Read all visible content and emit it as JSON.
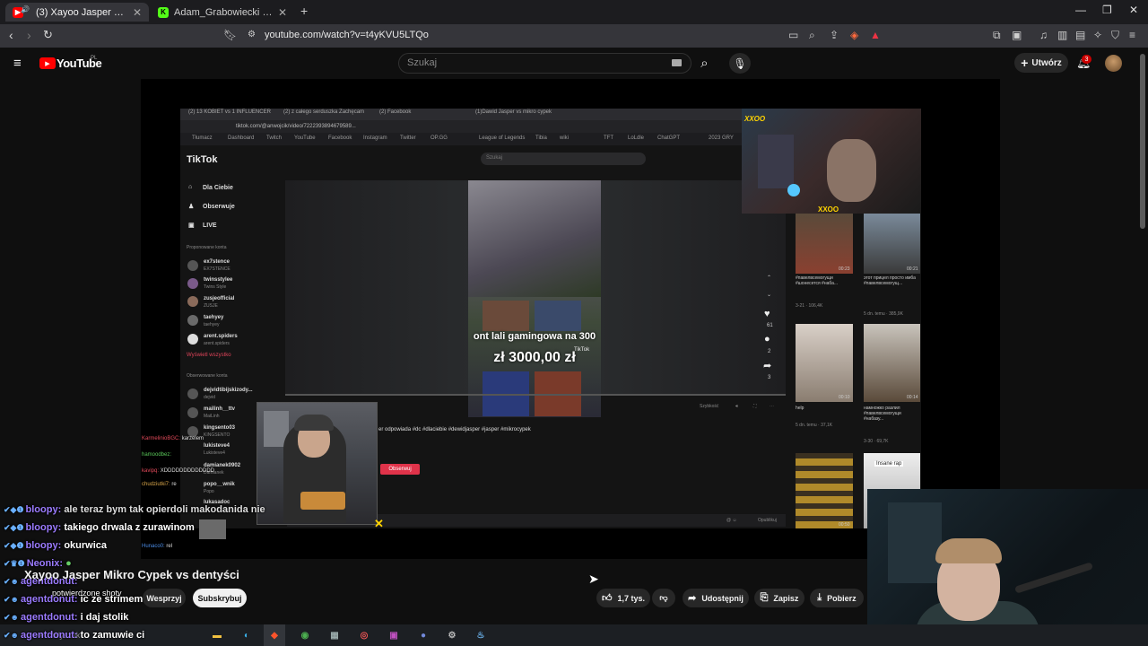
{
  "browser": {
    "tabs": [
      {
        "title": "(3) Xayoo Jasper Mikro Cypek",
        "active": true
      },
      {
        "title": "Adam_Grabowiecki Stream - Watch L",
        "active": false
      }
    ],
    "url": "youtube.com/watch?v=t4yKVU5LTQo"
  },
  "youtube": {
    "logo": "YouTube",
    "region": "PL",
    "search_placeholder": "Szukaj",
    "create_label": "Utwórz",
    "notification_count": "3",
    "video_title": "Xayoo Jasper Mikro Cypek vs dentyści",
    "support_label": "Wesprzyj",
    "subscribe_label": "Subskrybuj",
    "like_count": "1,7 tys.",
    "share_label": "Udostępnij",
    "save_label": "Zapisz",
    "download_label": "Pobierz"
  },
  "stream": {
    "inner_tabs": [
      "(2) 13 KOBIET vs 1 INFLUENCER",
      "(2) z całego serduszka Zachęcam",
      "(2) Facebook",
      "(1)Dawid Jasper vs mikro cypek"
    ],
    "inner_url": "tiktok.com/@anwojcik/video/7222393894679589...",
    "bookmarks": [
      "Tłumacz",
      "Dashboard",
      "Twitch",
      "YouTube",
      "Facebook",
      "Instagram",
      "Twitter",
      "OP.GG",
      "League of Legends",
      "Tibia",
      "wiki",
      "TFT",
      "LoLdle",
      "ChatGPT",
      "2023 GRY"
    ],
    "tiktok": {
      "logo": "TikTok",
      "search_ph": "Szukaj",
      "nav": [
        "Dla Ciebie",
        "Obserwuje",
        "LIVE"
      ],
      "suggested_header": "Proponowane konta",
      "suggested": [
        {
          "name": "ex7stence",
          "sub": "EX7STENCE"
        },
        {
          "name": "twinsstylee",
          "sub": "Twins Style"
        },
        {
          "name": "zusjeofficial",
          "sub": "ZUSJE"
        },
        {
          "name": "taehyey",
          "sub": "taehyey"
        },
        {
          "name": "arent.spiders",
          "sub": "arent.spiders"
        }
      ],
      "see_all": "Wyświetl wszystko",
      "followed_header": "Obserwowane konta",
      "followed": [
        {
          "name": "dejvidtibijskizody...",
          "sub": "dejvid"
        },
        {
          "name": "mailinh__ttv",
          "sub": "MaiLinh"
        },
        {
          "name": "kingsento03",
          "sub": "KINGSENTO"
        },
        {
          "name": "lukisteve4",
          "sub": "Lukisteve4"
        },
        {
          "name": "damianek0902",
          "sub": "Damianek"
        },
        {
          "name": "popo__wnik",
          "sub": "Popo"
        },
        {
          "name": "lukasadoc",
          "sub": ""
        }
      ],
      "video_text1": "ont lali gamingowa na 300",
      "video_text2": "zł 3000,00 zł",
      "watermark": "TikTok",
      "side_counts": [
        "61",
        "2",
        "3"
      ],
      "speed_label": "Szybkość",
      "caption": "er odpowiada #dc #dlaciebie #dewidjasper #jasper #mikrocypek",
      "follow_btn": "Obserwuj",
      "comment_btn": "Opublikuj"
    },
    "overlay_chat": [
      {
        "user": "KarmelinioBGC:",
        "msg": "karzelem"
      },
      {
        "user": "hamoodbez:",
        "msg": ""
      },
      {
        "user": "kavipq:",
        "msg": "XDDDDDDDDDDDDD"
      },
      {
        "user": "chudziutki7:",
        "msg": "re"
      },
      {
        "user": "Hunaco0:",
        "msg": "rel"
      }
    ],
    "cam_label": "XXOO",
    "recommendations": [
      {
        "title": "#павелвсемогущи #шонесется #наба...",
        "meta": "3-21 · 106,4K"
      },
      {
        "title": "этот прицел просто имба #павелвсемогущ...",
        "meta": "5 dn. temu · 385,9K"
      },
      {
        "title": "help",
        "meta": "5 dn. temu · 37,1K"
      },
      {
        "title": "намножко разлил #павелвсемогущи #набазу...",
        "meta": "3-30 · 69,7K"
      }
    ],
    "rec_durations": [
      "00:23",
      "00:21",
      "00:10",
      "00:14",
      "00:50"
    ],
    "insane_label": "Insane rap"
  },
  "chat": [
    {
      "user": "bloopy:",
      "msg": "ale teraz bym tak opierdoli makodanida nie"
    },
    {
      "user": "bloopy:",
      "msg": "takiego drwala z zurawinom"
    },
    {
      "user": "bloopy:",
      "msg": "okurwica"
    },
    {
      "user": "Neonix:",
      "msg": ""
    },
    {
      "user": "agentdonut:",
      "msg": ""
    },
    {
      "user": "agentdonut:",
      "msg": "potwierdzone shoty"
    },
    {
      "user": "agentdonut:",
      "msg": "ic ze strimem"
    },
    {
      "user": "agentdonut:",
      "msg": "i daj stolik"
    },
    {
      "user": "agentdonut:",
      "msg": "to zamuwie ci"
    }
  ],
  "taskbar": {
    "search_placeholder": "Wyszuk"
  },
  "colors": {
    "yt_red": "#ff0000",
    "chat_user": "#9b7bff",
    "taskbar": "#1c1f23"
  }
}
